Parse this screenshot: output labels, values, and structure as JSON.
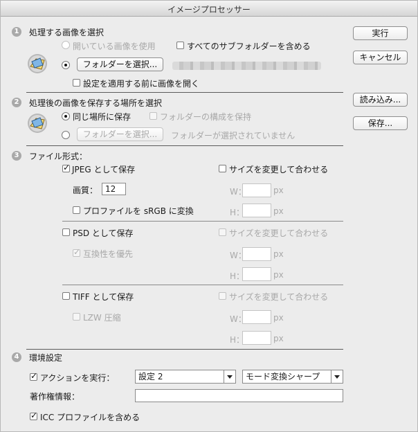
{
  "window": {
    "title": "イメージプロセッサー"
  },
  "buttons": {
    "run": "実行",
    "cancel": "キャンセル",
    "load": "読み込み...",
    "save": "保存..."
  },
  "section1": {
    "number": "1",
    "heading": "処理する画像を選択",
    "use_open_images": "開いている画像を使用",
    "include_subfolders": "すべてのサブフォルダーを含める",
    "select_folder_button": "フォルダーを選択...",
    "open_first_image": "設定を適用する前に画像を開く"
  },
  "section2": {
    "number": "2",
    "heading": "処理後の画像を保存する場所を選択",
    "same_location": "同じ場所に保存",
    "keep_folder_structure": "フォルダーの構成を保持",
    "select_folder_button": "フォルダーを選択...",
    "no_folder_selected": "フォルダーが選択されていません"
  },
  "section3": {
    "number": "3",
    "heading": "ファイル形式：",
    "jpeg": {
      "save_as": "JPEG として保存",
      "resize_to_fit": "サイズを変更して合わせる",
      "quality_label": "画質：",
      "quality_value": "12",
      "convert_srgb": "プロファイルを sRGB に変換",
      "w_label": "W：",
      "h_label": "H：",
      "unit": "px"
    },
    "psd": {
      "save_as": "PSD として保存",
      "resize_to_fit": "サイズを変更して合わせる",
      "maximize_compat": "互換性を優先",
      "w_label": "W：",
      "h_label": "H：",
      "unit": "px"
    },
    "tiff": {
      "save_as": "TIFF として保存",
      "resize_to_fit": "サイズを変更して合わせる",
      "lzw": "LZW 圧縮",
      "w_label": "W：",
      "h_label": "H：",
      "unit": "px"
    }
  },
  "section4": {
    "number": "4",
    "heading": "環境設定",
    "run_action": "アクションを実行：",
    "action_set": "設定 2",
    "action_name": "モード変換シャープ",
    "copyright_label": "著作権情報：",
    "copyright_value": "",
    "include_icc": "ICC プロファイルを含める"
  },
  "icons": {
    "check": "✓",
    "bridge_icon": "bridge-app-icon"
  }
}
